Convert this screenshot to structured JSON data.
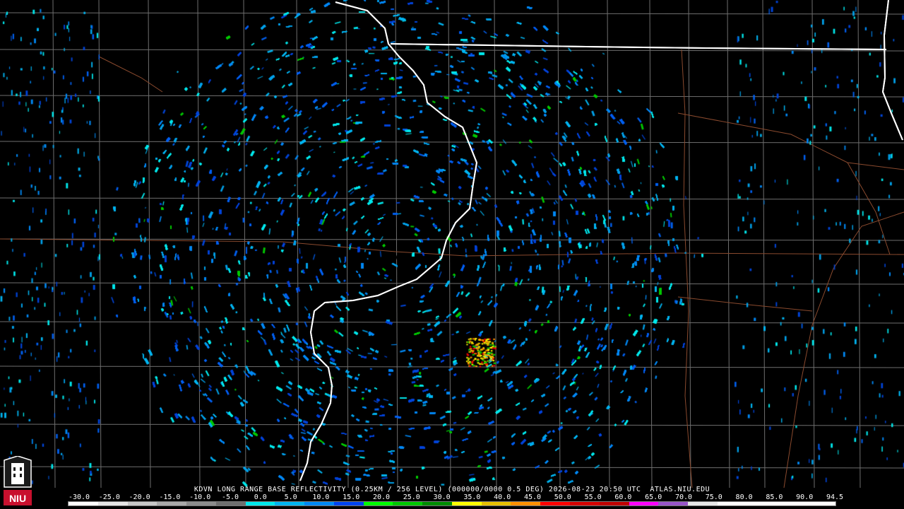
{
  "title": "KDVN LONG RANGE BASE REFLECTIVITY (0.25KM / 256 LEVEL) (000000/0000 0.5 DEG) 2026-08-23 20:50 UTC  ATLAS.NIU.EDU",
  "logo_text": "NIU",
  "colors": {
    "background": "#000000",
    "county_lines": "#6e6e6e",
    "state_lines": "#ffffff",
    "roads": "#8a4a2e",
    "radar_site": "#000000"
  },
  "scale": {
    "labels": [
      "-30.0",
      "-25.0",
      "-20.0",
      "-15.0",
      "-10.0",
      "-5.0",
      "0.0",
      "5.0",
      "10.0",
      "15.0",
      "20.0",
      "25.0",
      "30.0",
      "35.0",
      "40.0",
      "45.0",
      "50.0",
      "55.0",
      "60.0",
      "65.0",
      "70.0",
      "75.0",
      "80.0",
      "85.0",
      "90.0",
      "94.5"
    ],
    "colors": [
      "#ffffff",
      "#e6e6e6",
      "#c8c8c8",
      "#aaaaaa",
      "#8c8c8c",
      "#6e6e6e",
      "#00e8ec",
      "#00b4f0",
      "#0088f4",
      "#0044f0",
      "#00ff00",
      "#00c800",
      "#008c00",
      "#ffff00",
      "#e7c000",
      "#ff9000",
      "#ff0000",
      "#d60000",
      "#c00000",
      "#ff00ff",
      "#9955c9",
      "#e8e8e8",
      "#ffffff",
      "#ffffff",
      "#ffffff",
      "#ffffff"
    ]
  }
}
